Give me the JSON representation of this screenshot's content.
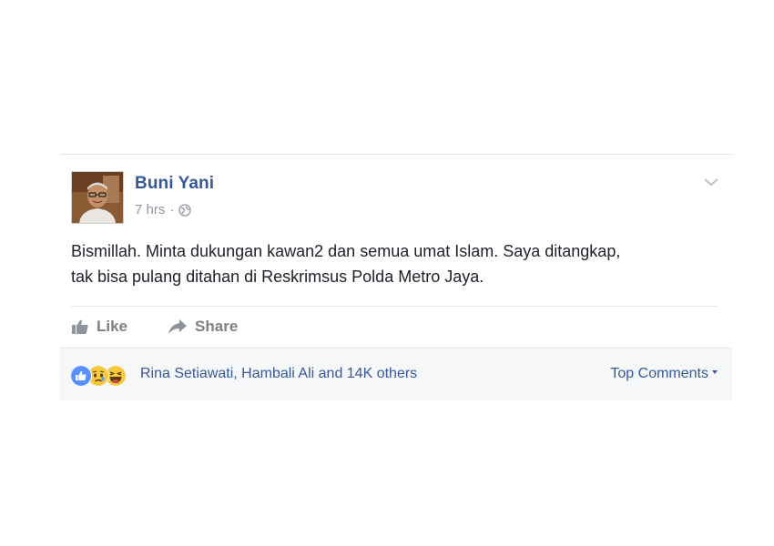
{
  "post": {
    "author": "Buni Yani",
    "time": "7 hrs",
    "separator": "·",
    "privacy_icon": "globe-icon",
    "menu_icon": "chevron-down-icon",
    "text_line1": "Bismillah. Minta dukungan kawan2 dan semua umat Islam. Saya ditangkap,",
    "text_line2": "tak bisa pulang ditahan di Reskrimsus Polda Metro Jaya."
  },
  "actions": {
    "like_label": "Like",
    "like_icon": "thumbs-up-icon",
    "share_label": "Share",
    "share_icon": "share-arrow-icon"
  },
  "reactions": {
    "icons": [
      "like-reaction-icon",
      "sad-reaction-icon",
      "haha-reaction-icon"
    ],
    "summary": "Rina Setiawati, Hambali Ali and 14K others",
    "sort_label": "Top Comments"
  },
  "colors": {
    "link_blue": "#365899",
    "text": "#1d2129",
    "muted": "#90949c",
    "like_blue": "#5890ff",
    "reaction_yellow": "#f7c73d"
  }
}
